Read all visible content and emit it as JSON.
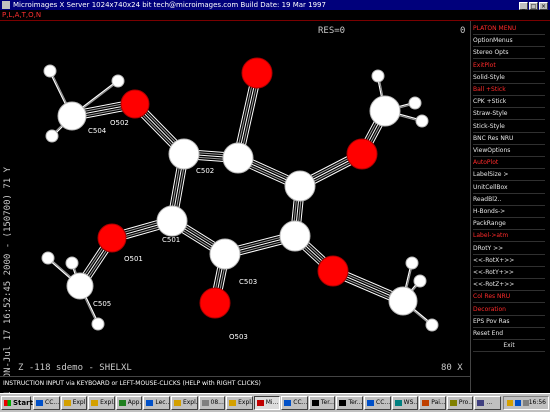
{
  "window": {
    "title": "Microimages X Server  1024x740x24 bit  tech@microimages.com  Build Date: 19 Mar 1997",
    "menu_label": "P,L,A,T,O,N"
  },
  "plot": {
    "res_label": "RES=0",
    "zero_label": "0",
    "vertical_label": "PLATON-Jul 17 16:52:45 2000 - (150700)  71 Y",
    "status_left": "Z  -118   sdemo  - SHELXL",
    "status_right": "80 X",
    "atom_labels": {
      "c501": "C501",
      "c502": "C502",
      "c503": "C503",
      "c504": "C504",
      "c505": "C505",
      "o501": "O501",
      "o502": "O502",
      "o503": "O503"
    }
  },
  "instruction": "INSTRUCTION INPUT via KEYBOARD or LEFT-MOUSE-CLICKS (HELP with RIGHT CLICKS)",
  "side_menu": [
    {
      "label": "PLATON MENU",
      "style": "hdr"
    },
    {
      "label": "OptionMenus",
      "style": "normal"
    },
    {
      "label": "Stereo Opts",
      "style": "normal"
    },
    {
      "label": "ExitPlot",
      "style": "red"
    },
    {
      "label": "Solid-Style",
      "style": "normal"
    },
    {
      "label": "Ball  +Stick",
      "style": "red"
    },
    {
      "label": "CPK   +Stick",
      "style": "normal"
    },
    {
      "label": "Straw-Style",
      "style": "normal"
    },
    {
      "label": "Stick-Style",
      "style": "normal"
    },
    {
      "label": "BNC Res NRU",
      "style": "normal"
    },
    {
      "label": "ViewOptions",
      "style": "normal"
    },
    {
      "label": "AutoPlot",
      "style": "red"
    },
    {
      "label": "LabelSize >",
      "style": "normal"
    },
    {
      "label": "UnitCellBox",
      "style": "normal"
    },
    {
      "label": "ReadBl2..",
      "style": "normal"
    },
    {
      "label": "H-Bonds->",
      "style": "normal"
    },
    {
      "label": "PackRange",
      "style": "normal"
    },
    {
      "label": "Label->atm",
      "style": "red"
    },
    {
      "label": "DRotY >>",
      "style": "normal"
    },
    {
      "label": "<<-RotX+>>",
      "style": "normal"
    },
    {
      "label": "<<-RotY+>>",
      "style": "normal"
    },
    {
      "label": "<<-RotZ+>>",
      "style": "normal"
    },
    {
      "label": "Col Res NRU",
      "style": "red"
    },
    {
      "label": "Decoration",
      "style": "red"
    },
    {
      "label": "EPS Pov Ras",
      "style": "normal"
    },
    {
      "label": "Reset   End",
      "style": "normal"
    },
    {
      "label": "Exit",
      "style": "normal"
    }
  ],
  "taskbar": {
    "start_label": "Start",
    "buttons": [
      {
        "label": "CC...",
        "icon_color": "#0050c8",
        "active": false
      },
      {
        "label": "Expl...",
        "icon_color": "#d4a000",
        "active": false
      },
      {
        "label": "Expl...",
        "icon_color": "#d4a000",
        "active": false
      },
      {
        "label": "App...",
        "icon_color": "#208020",
        "active": false
      },
      {
        "label": "Lec...",
        "icon_color": "#0050c8",
        "active": false
      },
      {
        "label": "Expl...",
        "icon_color": "#d4a000",
        "active": false
      },
      {
        "label": "08...",
        "icon_color": "#808080",
        "active": false
      },
      {
        "label": "Expl...",
        "icon_color": "#d4a000",
        "active": false
      },
      {
        "label": "Mi...",
        "icon_color": "#c00000",
        "active": true
      },
      {
        "label": "CC...",
        "icon_color": "#0050c8",
        "active": false
      },
      {
        "label": "Ter...",
        "icon_color": "#000000",
        "active": false
      },
      {
        "label": "Ter...",
        "icon_color": "#000000",
        "active": false
      },
      {
        "label": "CC...",
        "icon_color": "#0050c8",
        "active": false
      },
      {
        "label": "WS...",
        "icon_color": "#008080",
        "active": false
      },
      {
        "label": "Pai...",
        "icon_color": "#c04000",
        "active": false
      },
      {
        "label": "Pro...",
        "icon_color": "#808000",
        "active": false
      },
      {
        "label": "...",
        "icon_color": "#404080",
        "active": false
      }
    ],
    "clock": "16:56"
  }
}
